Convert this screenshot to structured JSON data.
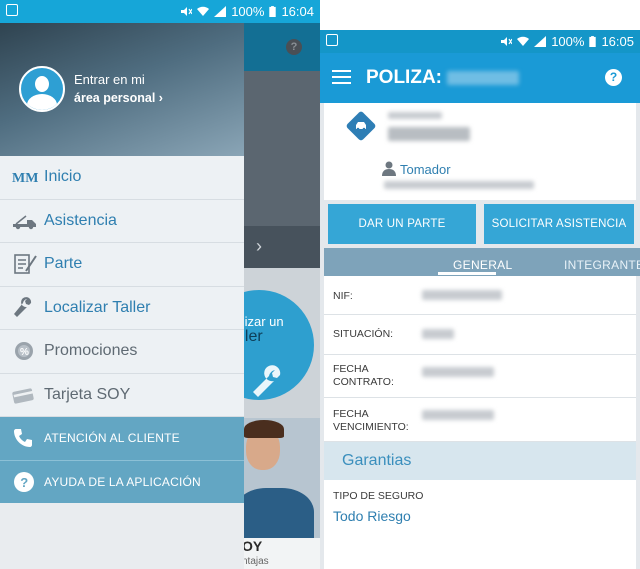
{
  "left_screen": {
    "status": {
      "battery": "100%",
      "time": "16:04"
    },
    "drawer": {
      "login_line1": "Entrar en mi",
      "login_line2": "área personal",
      "items": [
        {
          "label": "Inicio",
          "icon": "mm-logo-icon"
        },
        {
          "label": "Asistencia",
          "icon": "tow-truck-icon"
        },
        {
          "label": "Parte",
          "icon": "document-pen-icon"
        },
        {
          "label": "Localizar Taller",
          "icon": "wrench-icon"
        },
        {
          "label": "Promociones",
          "icon": "percent-gear-icon"
        },
        {
          "label": "Tarjeta SOY",
          "icon": "card-icon"
        }
      ],
      "actions": [
        {
          "label": "ATENCIÓN AL CLIENTE",
          "icon": "phone-icon"
        },
        {
          "label": "AYUDA DE LA APLICACIÓN",
          "icon": "help-icon"
        }
      ]
    },
    "background": {
      "circle_line1": "calizar un",
      "circle_line2": "taller",
      "bottom_title": "OY",
      "bottom_sub": "ntajas"
    }
  },
  "right_screen": {
    "status": {
      "battery": "100%",
      "time": "16:05"
    },
    "title": "POLIZA:",
    "tomador_label": "Tomador",
    "buttons": {
      "parte": "DAR UN PARTE",
      "asistencia": "SOLICITAR ASISTENCIA"
    },
    "tabs": [
      {
        "label": "GENERAL",
        "active": true
      },
      {
        "label": "INTEGRANTE",
        "active": false
      }
    ],
    "details": [
      {
        "label": "NIF:"
      },
      {
        "label": "SITUACIÓN:"
      },
      {
        "label_lines": [
          "FECHA",
          "CONTRATO:"
        ]
      },
      {
        "label_lines": [
          "FECHA",
          "VENCIMIENTO:"
        ]
      }
    ],
    "section_title": "Garantias",
    "seguro_label": "TIPO DE SEGURO",
    "seguro_value": "Todo Riesgo"
  },
  "colors": {
    "primary": "#1a9ad6",
    "button": "#35a6d6",
    "accent_text": "#2f7fb0"
  }
}
